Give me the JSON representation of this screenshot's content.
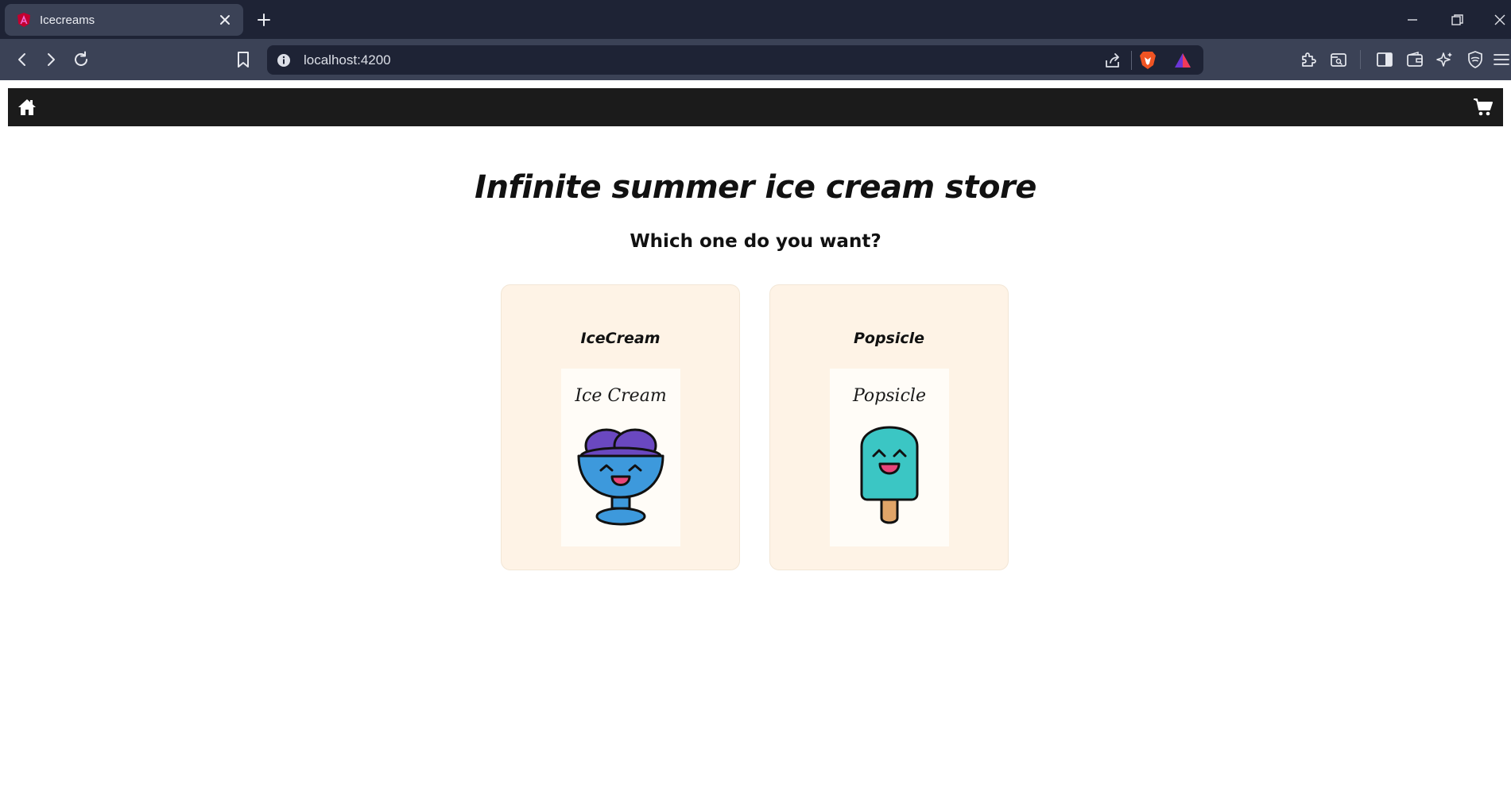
{
  "browser": {
    "tab": {
      "title": "Icecreams"
    },
    "url": "localhost:4200"
  },
  "page": {
    "title": "Infinite summer ice cream store",
    "subtitle": "Which one do you want?"
  },
  "products": [
    {
      "title": "IceCream",
      "image_caption": "Ice Cream",
      "icon": "ice-cream-bowl-icon"
    },
    {
      "title": "Popsicle",
      "image_caption": "Popsicle",
      "icon": "popsicle-icon"
    }
  ],
  "colors": {
    "chrome_dark": "#1e2335",
    "chrome_toolbar": "#3b4256",
    "navbar": "#1b1b1b",
    "card_bg": "#fef3e6",
    "ice_cream_scoop": "#6a48c0",
    "ice_cream_bowl": "#3d99dc",
    "popsicle": "#3bc6c4",
    "stick": "#e0a468",
    "mouth": "#e8457a"
  }
}
